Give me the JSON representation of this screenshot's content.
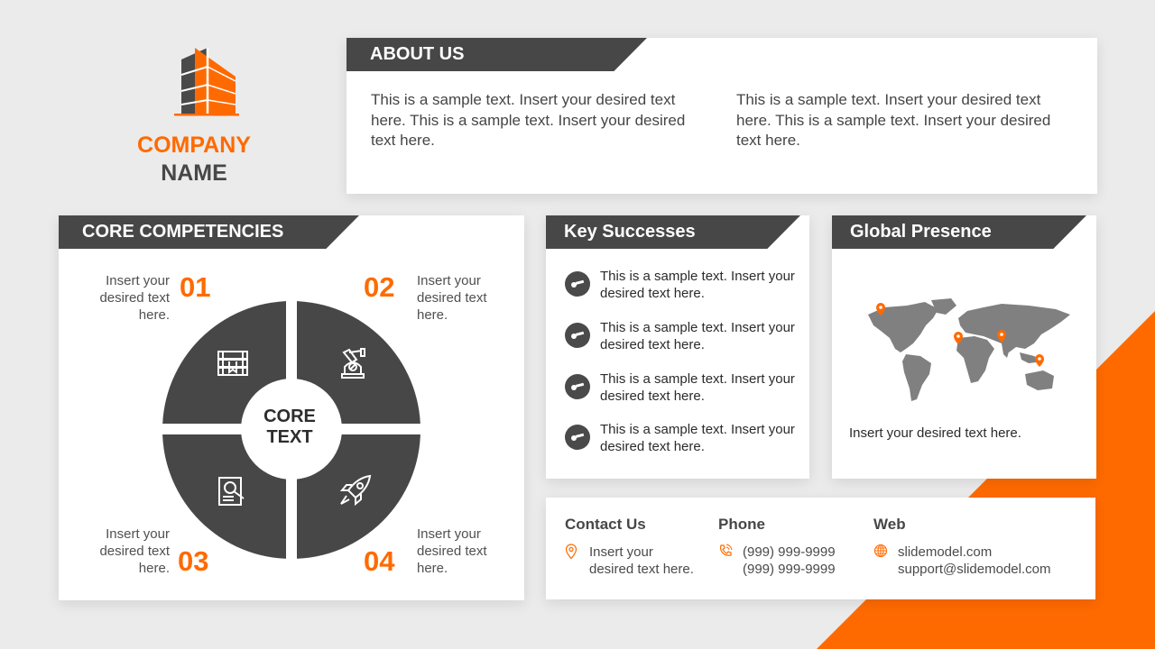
{
  "colors": {
    "accent": "#ff6a00",
    "dark": "#474747",
    "background": "#ebebeb",
    "card": "#ffffff",
    "map": "#808080"
  },
  "logo": {
    "icon": "building-icon",
    "line1": "COMPANY",
    "line2": "NAME"
  },
  "about": {
    "title": "ABOUT US",
    "paragraphs": [
      "This is a sample text. Insert your desired text here. This is a sample text. Insert your desired text here.",
      "This is a sample text. Insert your desired text here. This is a sample text. Insert your desired text here."
    ]
  },
  "core": {
    "title": "CORE COMPETENCIES",
    "center_line1": "CORE",
    "center_line2": "TEXT",
    "items": [
      {
        "number": "01",
        "text": "Insert your desired text here.",
        "icon": "books-icon"
      },
      {
        "number": "02",
        "text": "Insert your desired text here.",
        "icon": "robot-arm-icon"
      },
      {
        "number": "03",
        "text": "Insert your desired text here.",
        "icon": "document-search-icon"
      },
      {
        "number": "04",
        "text": "Insert your desired text here.",
        "icon": "rocket-icon"
      }
    ]
  },
  "key_successes": {
    "title": "Key Successes",
    "icon": "key-icon",
    "items": [
      "This is a sample text.  Insert your desired text  here.",
      "This is a sample text.  Insert your desired text  here.",
      "This is a sample text.  Insert your desired text  here.",
      "This is a sample text.  Insert your desired text  here."
    ]
  },
  "global_presence": {
    "title": "Global Presence",
    "map_icon": "world-map-icon",
    "pin_icon": "map-pin-icon",
    "pins": [
      "Alaska",
      "Western Europe / North Africa",
      "India",
      "Indonesia / Northern Australia"
    ],
    "text": "Insert your desired text  here."
  },
  "contact": {
    "contact_us": {
      "title": "Contact Us",
      "icon": "location-pin-icon",
      "lines": [
        "Insert your",
        "desired text  here."
      ]
    },
    "phone": {
      "title": "Phone",
      "icon": "phone-icon",
      "lines": [
        "(999) 999-9999",
        "(999) 999-9999"
      ]
    },
    "web": {
      "title": "Web",
      "icon": "globe-icon",
      "lines": [
        "slidemodel.com",
        "support@slidemodel.com"
      ]
    }
  }
}
